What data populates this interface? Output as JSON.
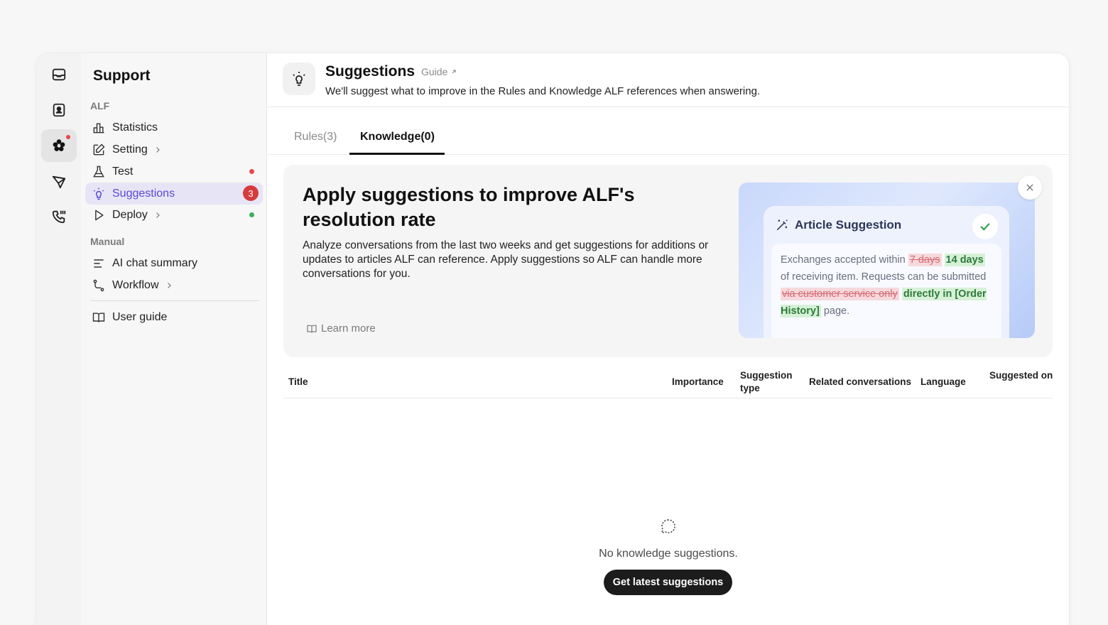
{
  "sidebar": {
    "title": "Support",
    "section_alf": "ALF",
    "section_manual": "Manual",
    "items": {
      "statistics": "Statistics",
      "setting": "Setting",
      "test": "Test",
      "suggestions": "Suggestions",
      "suggestions_badge": "3",
      "deploy": "Deploy",
      "ai_chat_summary": "AI chat summary",
      "workflow": "Workflow",
      "user_guide": "User guide"
    },
    "status_colors": {
      "test": "#e5484d",
      "deploy": "#3ab05a"
    }
  },
  "header": {
    "title": "Suggestions",
    "guide_link": "Guide",
    "description": "We'll suggest what to improve in the Rules and Knowledge ALF references when answering."
  },
  "tabs": {
    "rules": "Rules(3)",
    "knowledge": "Knowledge(0)",
    "active": "knowledge"
  },
  "banner": {
    "title": "Apply suggestions to improve ALF's resolution rate",
    "description": "Analyze conversations from the last two weeks and get suggestions for additions or updates to articles ALF can reference. Apply suggestions so ALF can handle more conversations for you.",
    "learn_more": "Learn more",
    "card": {
      "title": "Article Suggestion",
      "text_1": "Exchanges accepted within",
      "deleted_1": "7 days",
      "inserted_1": "14 days",
      "text_2": "of receiving item. Requests can be submitted",
      "deleted_2": "via customer service only",
      "inserted_2": "directly in [Order History]",
      "text_3": "page."
    }
  },
  "table": {
    "columns": {
      "title": "Title",
      "importance": "Importance",
      "suggestion_type": "Suggestion type",
      "related_conversations": "Related conversations",
      "language": "Language",
      "suggested_on": "Suggested on"
    }
  },
  "empty_state": {
    "message": "No knowledge suggestions.",
    "button": "Get latest suggestions"
  },
  "colors": {
    "accent": "#5a47d6",
    "active_item_bg": "#e7e5f5",
    "badge": "#d63c3c",
    "primary_button": "#1c1c1c"
  }
}
